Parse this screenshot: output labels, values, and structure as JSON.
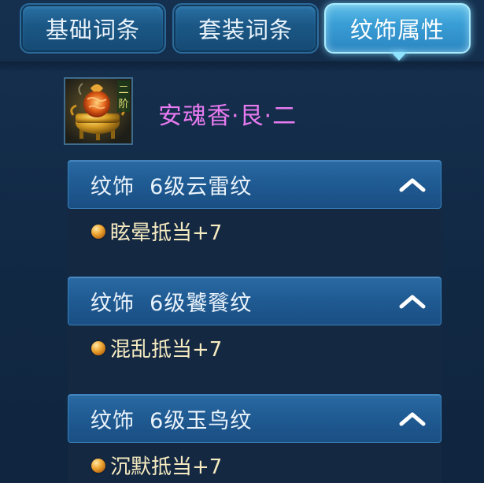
{
  "tabs": [
    {
      "label": "基础词条",
      "active": false
    },
    {
      "label": "套装词条",
      "active": false
    },
    {
      "label": "纹饰属性",
      "active": true
    }
  ],
  "item": {
    "icon": "incense-burner-icon",
    "grade_badge": "二阶",
    "name": "安魂香·艮·二",
    "name_color": "#e87af0"
  },
  "sections": [
    {
      "label": "纹饰  6级云雷纹",
      "attribute": "眩晕抵当+7",
      "expanded": true
    },
    {
      "label": "纹饰  6级饕餮纹",
      "attribute": "混乱抵当+7",
      "expanded": true
    },
    {
      "label": "纹饰  6级玉鸟纹",
      "attribute": "沉默抵当+7",
      "expanded": true
    }
  ],
  "colors": {
    "attribute_text": "#f6ebc0",
    "section_header": "#1f5a92",
    "active_tab": "#3a9ed6"
  }
}
